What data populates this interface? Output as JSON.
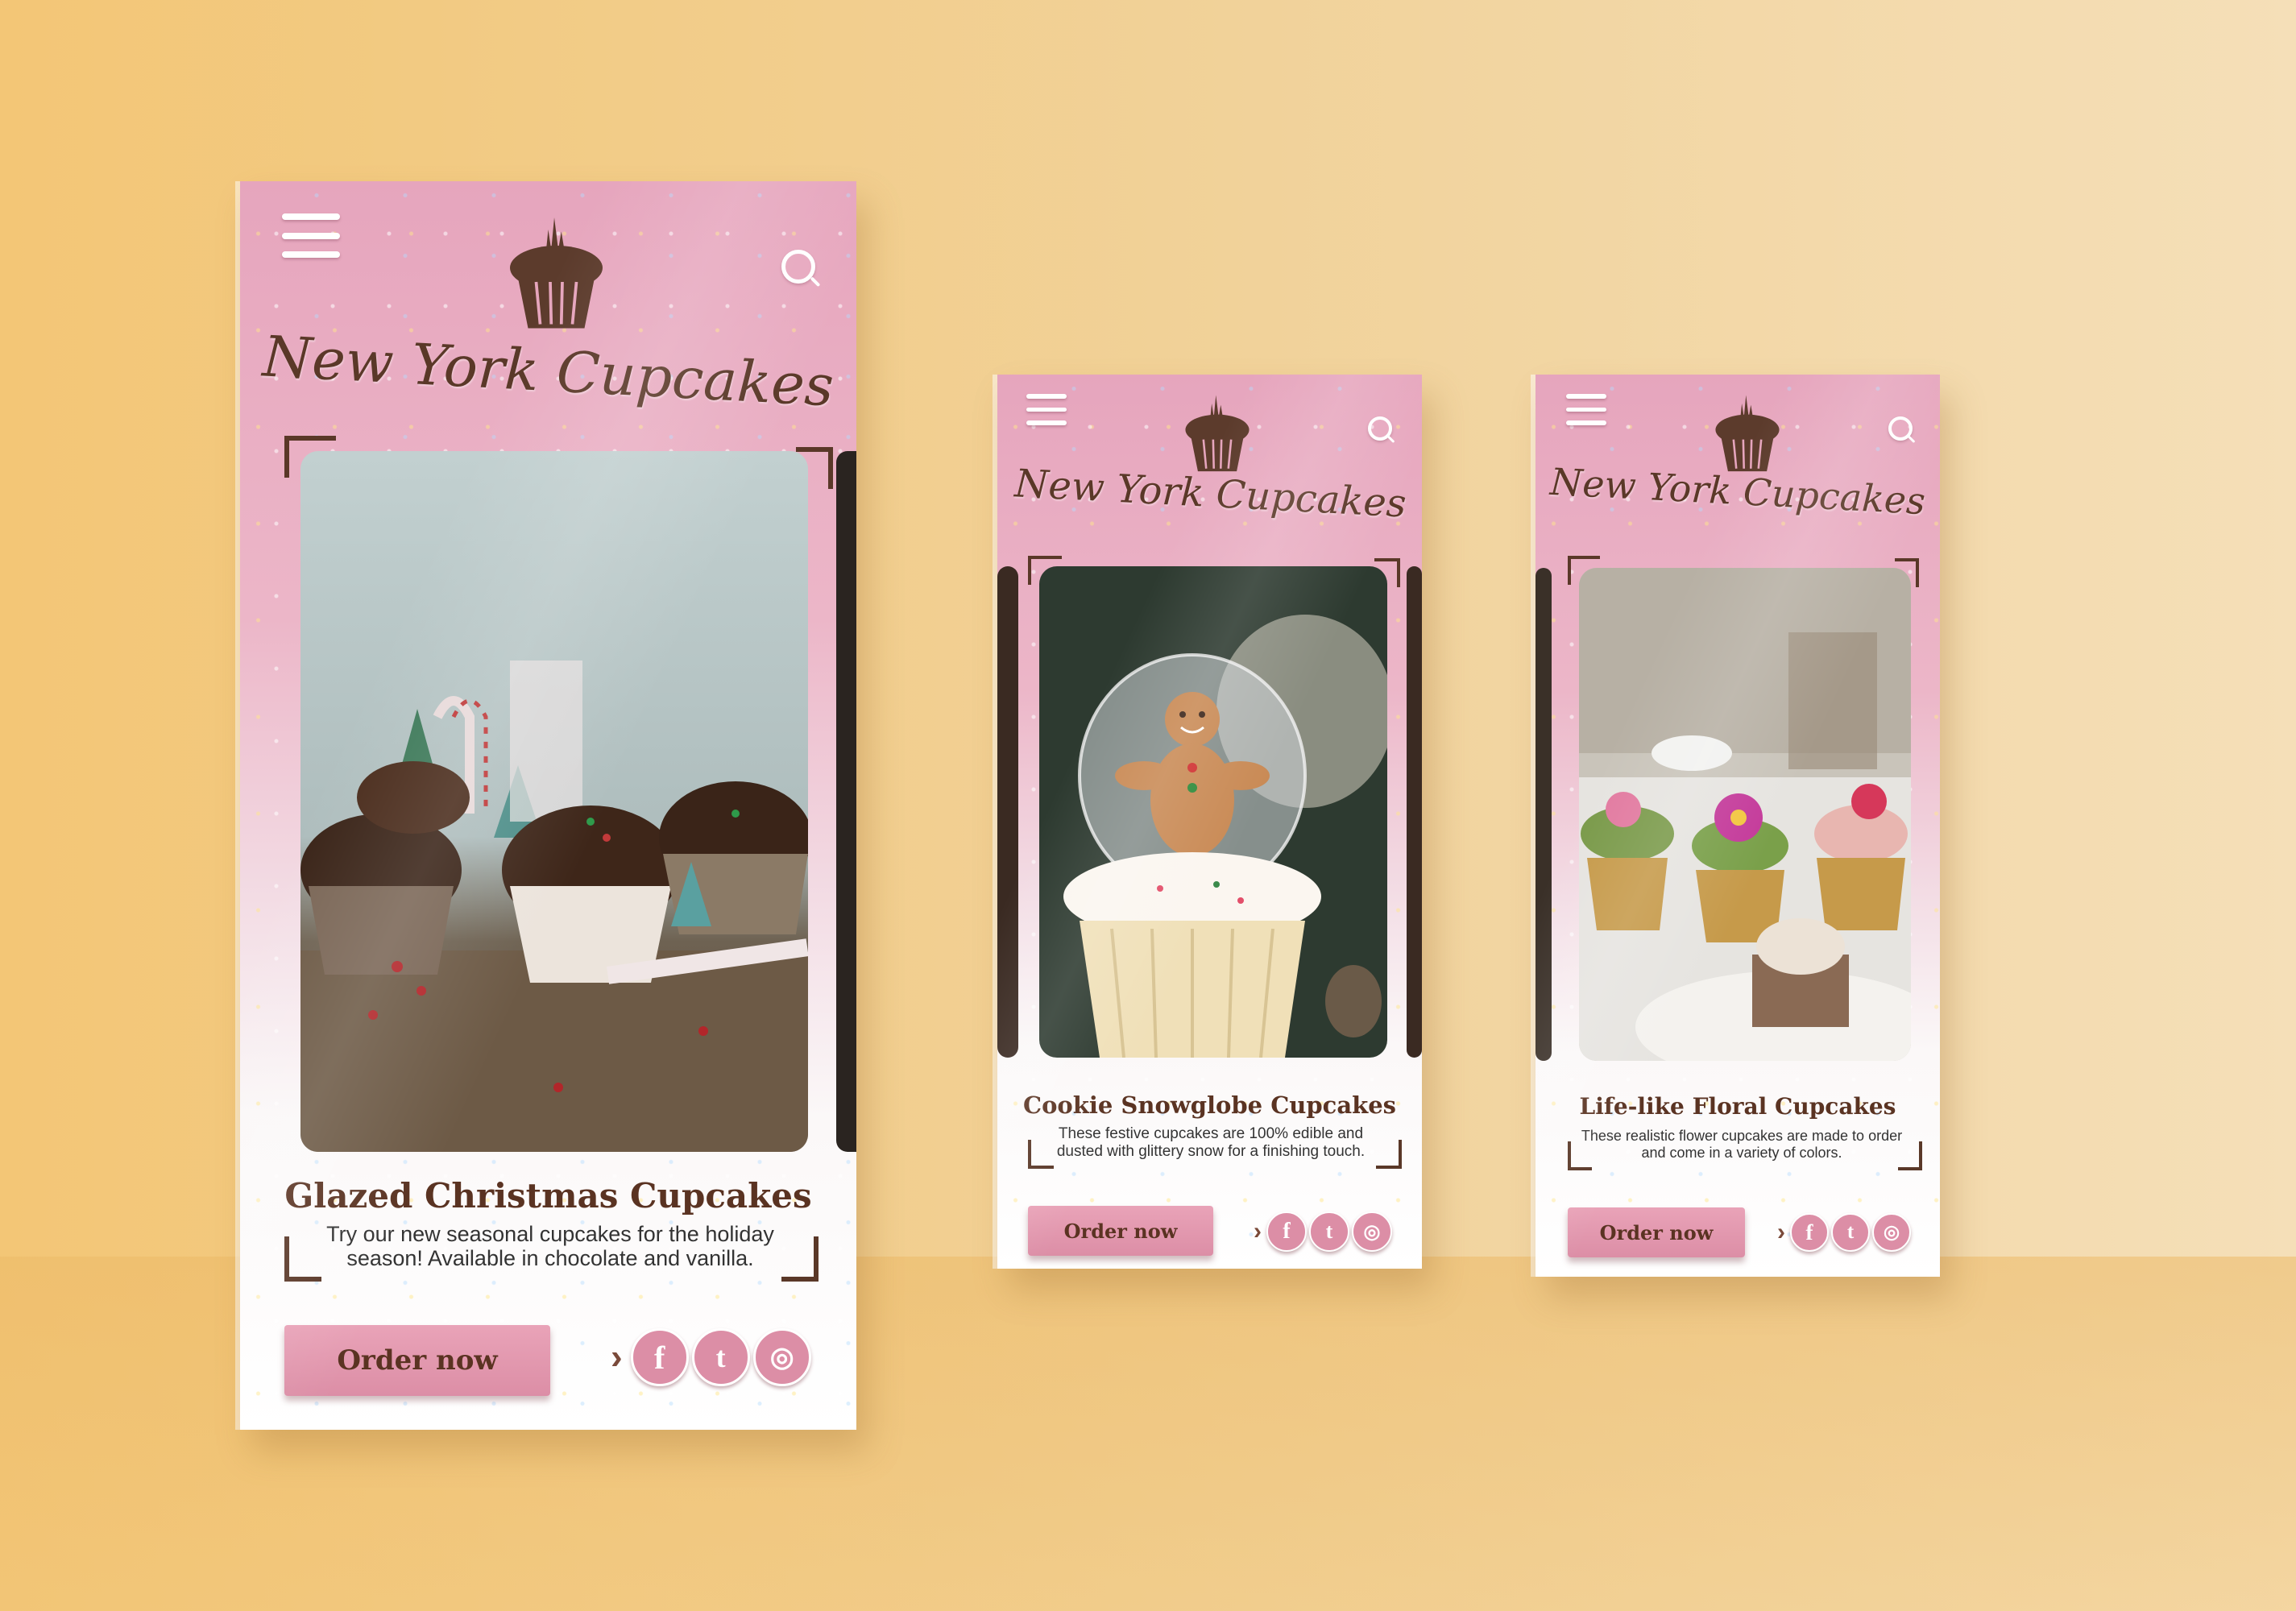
{
  "brand": "New York Cupcakes",
  "colors": {
    "background": "#f3c676",
    "phone_pink": "#e6a5bd",
    "button_pink": "#dc8ea6",
    "brown_text": "#5a3322"
  },
  "icons": [
    "menu-icon",
    "cupcake-logo-icon",
    "search-icon",
    "chevron-right-icon",
    "facebook-icon",
    "twitter-icon",
    "instagram-icon"
  ],
  "screens": [
    {
      "title": "Glazed Christmas Cupcakes",
      "description": "Try our new seasonal cupcakes for the holiday season! Available in chocolate and vanilla.",
      "order_label": "Order now",
      "facebook_glyph": "f",
      "twitter_glyph": "t",
      "instagram_glyph": "◎",
      "chevron": "›"
    },
    {
      "title": "Cookie Snowglobe Cupcakes",
      "description": "These festive cupcakes are 100% edible and dusted with glittery snow for a finishing touch.",
      "order_label": "Order now",
      "facebook_glyph": "f",
      "twitter_glyph": "t",
      "instagram_glyph": "◎",
      "chevron": "›"
    },
    {
      "title": "Life-like Floral Cupcakes",
      "description": "These realistic flower cupcakes are made to order and come in a variety of colors.",
      "order_label": "Order now",
      "facebook_glyph": "f",
      "twitter_glyph": "t",
      "instagram_glyph": "◎",
      "chevron": "›"
    }
  ]
}
